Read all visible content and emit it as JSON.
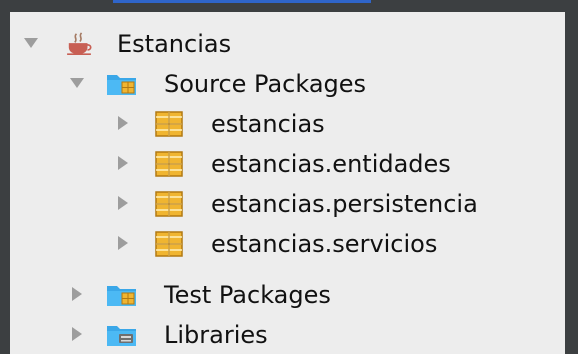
{
  "tree": {
    "project": {
      "label": "Estancias",
      "icon": "java-project-coffee-cup-icon",
      "expanded": true
    },
    "source_packages": {
      "label": "Source Packages",
      "icon": "source-packages-folder-icon",
      "expanded": true,
      "packages": [
        {
          "label": "estancias",
          "icon": "package-icon",
          "expanded": false
        },
        {
          "label": "estancias.entidades",
          "icon": "package-icon",
          "expanded": false
        },
        {
          "label": "estancias.persistencia",
          "icon": "package-icon",
          "expanded": false
        },
        {
          "label": "estancias.servicios",
          "icon": "package-icon",
          "expanded": false
        }
      ]
    },
    "test_packages": {
      "label": "Test Packages",
      "icon": "test-packages-folder-icon",
      "expanded": false
    },
    "libraries": {
      "label": "Libraries",
      "icon": "libraries-folder-icon",
      "expanded": false
    }
  },
  "colors": {
    "background": "#3c3f41",
    "panel": "#ededed",
    "accent": "#2f65ca",
    "folder": "#3aa7e8",
    "package": "#f0b531",
    "text": "#111111"
  }
}
